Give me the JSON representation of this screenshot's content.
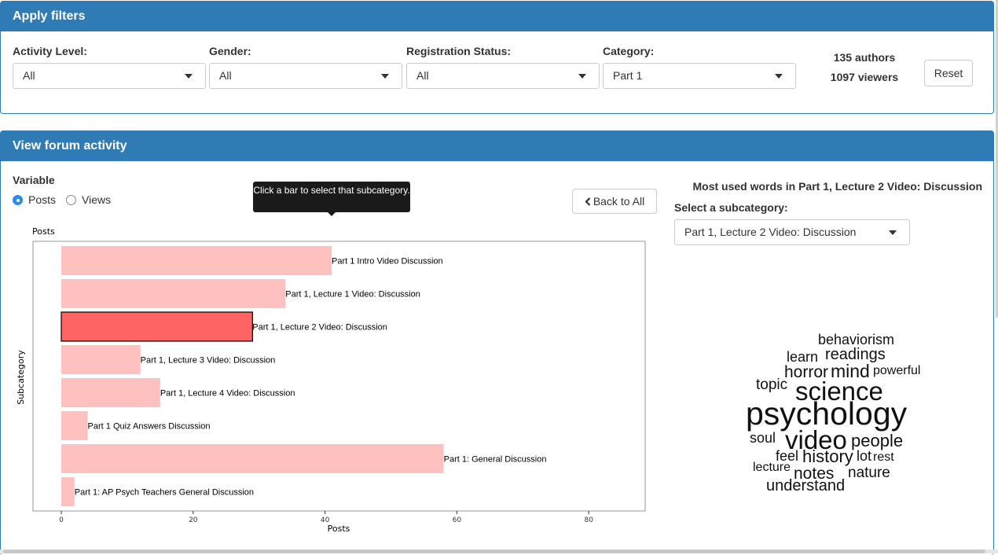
{
  "filters": {
    "title": "Apply filters",
    "activity_level": {
      "label": "Activity Level:",
      "value": "All"
    },
    "gender": {
      "label": "Gender:",
      "value": "All"
    },
    "registration": {
      "label": "Registration Status:",
      "value": "All"
    },
    "category": {
      "label": "Category:",
      "value": "Part 1"
    },
    "authors": "135 authors",
    "viewers": "1097 viewers",
    "reset_label": "Reset"
  },
  "forum": {
    "title": "View forum activity",
    "variable_label": "Variable",
    "radio_posts": "Posts",
    "radio_views": "Views",
    "selected_variable": "Posts",
    "tooltip": "Click a bar to select that subcategory.",
    "back_label": "Back to All",
    "back_icon": "chevron-left-icon",
    "wordcloud_title": "Most used words in Part 1, Lecture 2 Video: Discussion",
    "subcategory_label": "Select a subcategory:",
    "subcategory_value": "Part 1, Lecture 2 Video: Discussion"
  },
  "chart_data": {
    "type": "bar",
    "orientation": "horizontal",
    "title": "Posts",
    "xlabel": "Posts",
    "ylabel": "Subcategory",
    "xlim": [
      0,
      85
    ],
    "xticks": [
      0,
      20,
      40,
      60,
      80
    ],
    "categories": [
      "Part 1 Intro Video Discussion",
      "Part 1, Lecture 1 Video: Discussion",
      "Part 1, Lecture 2 Video: Discussion",
      "Part 1, Lecture 3 Video: Discussion",
      "Part 1, Lecture 4 Video: Discussion",
      "Part 1 Quiz Answers Discussion",
      "Part 1: General Discussion",
      "Part 1: AP Psych Teachers General Discussion"
    ],
    "values": [
      41,
      34,
      29,
      12,
      15,
      4,
      58,
      2
    ],
    "selected": "Part 1, Lecture 2 Video: Discussion",
    "colors": {
      "bar": "#ffc0c0",
      "selected": "#ff6464",
      "selected_stroke": "#000000"
    },
    "grid": false
  },
  "wordcloud": {
    "words": [
      {
        "text": "behaviorism",
        "weight": 3
      },
      {
        "text": "learn",
        "weight": 3
      },
      {
        "text": "readings",
        "weight": 3.5
      },
      {
        "text": "horror",
        "weight": 3.5
      },
      {
        "text": "mind",
        "weight": 4
      },
      {
        "text": "powerful",
        "weight": 2.5
      },
      {
        "text": "topic",
        "weight": 3
      },
      {
        "text": "science",
        "weight": 5
      },
      {
        "text": "psychology",
        "weight": 7
      },
      {
        "text": "soul",
        "weight": 3
      },
      {
        "text": "video",
        "weight": 6
      },
      {
        "text": "people",
        "weight": 3.5
      },
      {
        "text": "feel",
        "weight": 3
      },
      {
        "text": "history",
        "weight": 3.5
      },
      {
        "text": "lot",
        "weight": 3
      },
      {
        "text": "rest",
        "weight": 2.5
      },
      {
        "text": "lecture",
        "weight": 2.5
      },
      {
        "text": "notes",
        "weight": 3.5
      },
      {
        "text": "nature",
        "weight": 3
      },
      {
        "text": "understand",
        "weight": 3.5
      }
    ]
  }
}
